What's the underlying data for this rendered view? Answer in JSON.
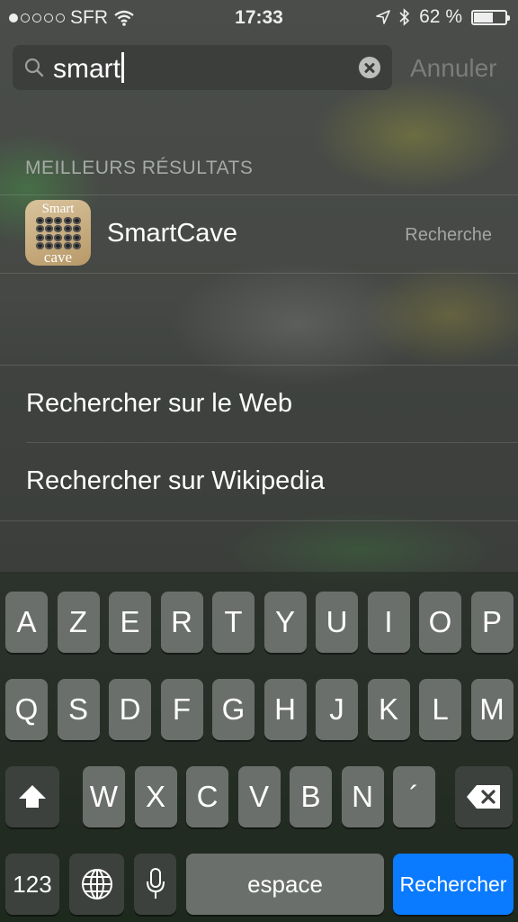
{
  "status": {
    "carrier": "SFR",
    "time": "17:33",
    "battery_percent": "62 %",
    "battery_level": 0.62,
    "signal_dots": [
      true,
      false,
      false,
      false,
      false
    ]
  },
  "search": {
    "value": "smart",
    "cancel_label": "Annuler"
  },
  "results": {
    "section_title": "MEILLEURS RÉSULTATS",
    "top_hit": {
      "icon_text_top": "Smart",
      "icon_text_bottom": "cave",
      "name": "SmartCave",
      "tag": "Recherche"
    }
  },
  "web_search": {
    "web_label": "Rechercher sur le Web",
    "wiki_label": "Rechercher sur Wikipedia"
  },
  "keyboard": {
    "row1": [
      "A",
      "Z",
      "E",
      "R",
      "T",
      "Y",
      "U",
      "I",
      "O",
      "P"
    ],
    "row2": [
      "Q",
      "S",
      "D",
      "F",
      "G",
      "H",
      "J",
      "K",
      "L",
      "M"
    ],
    "row3": [
      "W",
      "X",
      "C",
      "V",
      "B",
      "N",
      "´"
    ],
    "numbers_label": "123",
    "space_label": "espace",
    "search_label": "Rechercher"
  },
  "colors": {
    "accent": "#0a7aff"
  }
}
